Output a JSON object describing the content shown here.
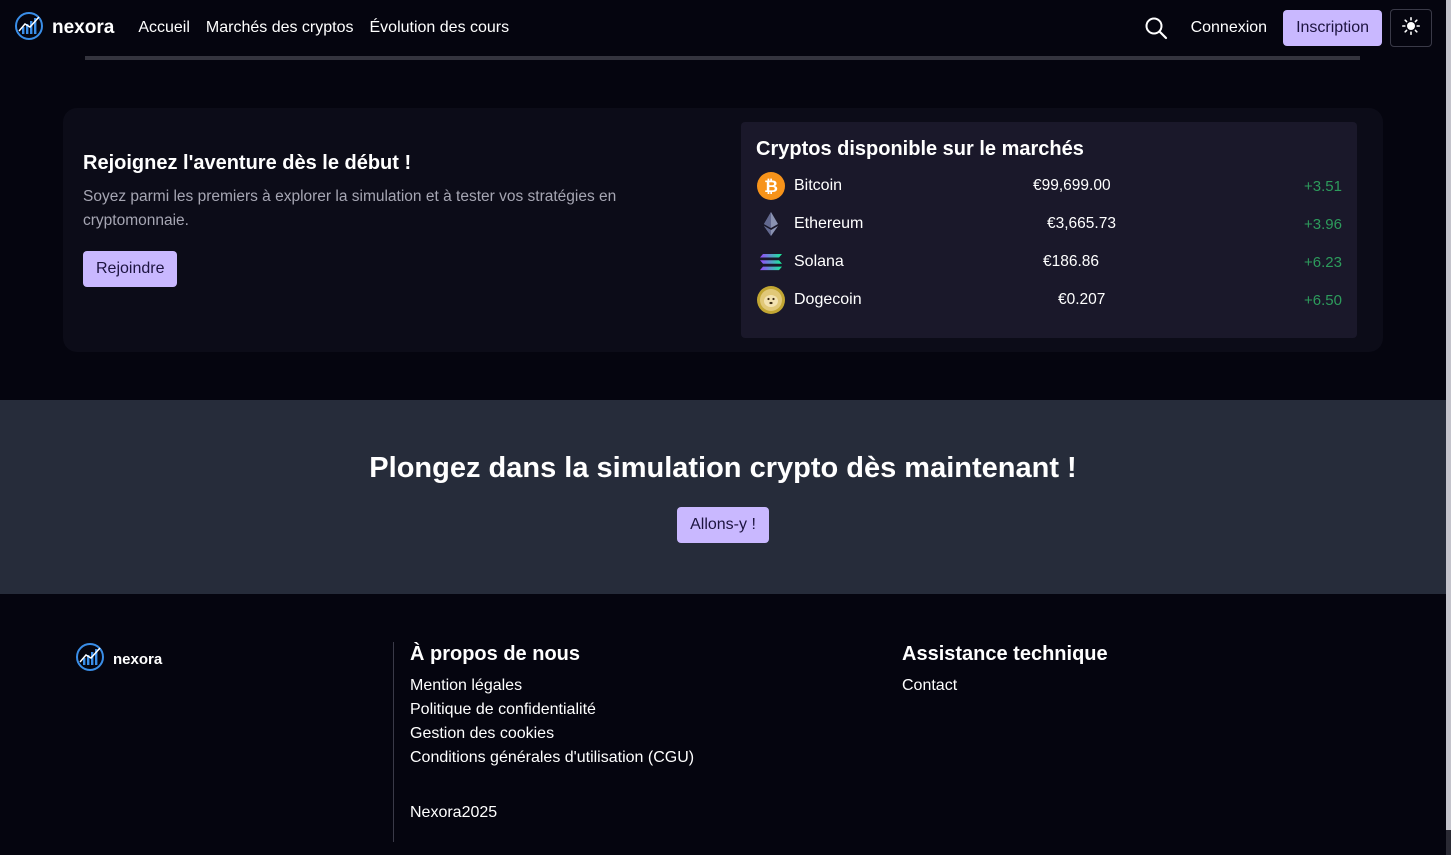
{
  "nav": {
    "brand": "nexora",
    "links": [
      "Accueil",
      "Marchés des cryptos",
      "Évolution des cours"
    ],
    "login": "Connexion",
    "signup": "Inscription",
    "icons": {
      "search": "search-icon",
      "theme": "sun-icon"
    }
  },
  "hero": {
    "title": "Rejoignez l'aventure dès le début !",
    "subtitle": "Soyez parmi les premiers à explorer la simulation et à tester vos stratégies en cryptomonnaie.",
    "button": "Rejoindre"
  },
  "market": {
    "title": "Cryptos disponible sur le marchés",
    "coins": [
      {
        "name": "Bitcoin",
        "price": "€99,699.00",
        "change": "+3.51",
        "icon": "bitcoin-icon"
      },
      {
        "name": "Ethereum",
        "price": "€3,665.73",
        "change": "+3.96",
        "icon": "ethereum-icon"
      },
      {
        "name": "Solana",
        "price": "€186.86",
        "change": "+6.23",
        "icon": "solana-icon"
      },
      {
        "name": "Dogecoin",
        "price": "€0.207",
        "change": "+6.50",
        "icon": "dogecoin-icon"
      }
    ]
  },
  "cta": {
    "title": "Plongez dans la simulation crypto dès maintenant !",
    "button": "Allons-y !"
  },
  "footer": {
    "brand": "nexora",
    "about": {
      "heading": "À propos de nous",
      "links": [
        "Mention légales",
        "Politique de confidentialité",
        "Gestion des cookies",
        "Conditions générales d'utilisation (CGU)"
      ]
    },
    "support": {
      "heading": "Assistance technique",
      "links": [
        "Contact"
      ]
    },
    "copyright": "Nexora2025"
  },
  "colors": {
    "background": "#05050f",
    "accent": "#c9b8ff",
    "positive": "#2d9b5c",
    "cta_band": "#262c3a"
  }
}
